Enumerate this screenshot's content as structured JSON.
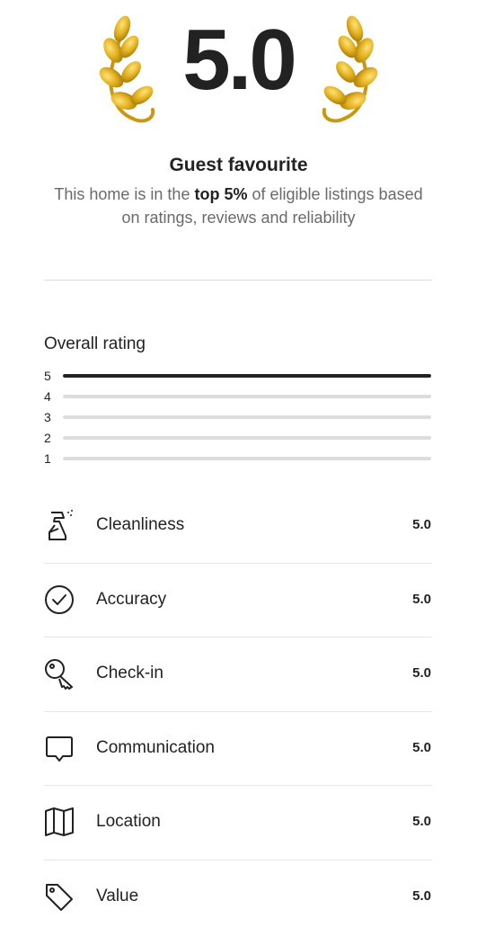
{
  "hero": {
    "score": "5.0",
    "title": "Guest favourite",
    "desc_prefix": "This home is in the ",
    "desc_highlight": "top 5%",
    "desc_suffix": " of eligible listings based on ratings, reviews and reliability",
    "laurel_color": "#D4A017"
  },
  "overall": {
    "title": "Overall rating",
    "bars": [
      {
        "label": "5",
        "fraction": 1.0
      },
      {
        "label": "4",
        "fraction": 0.0
      },
      {
        "label": "3",
        "fraction": 0.0
      },
      {
        "label": "2",
        "fraction": 0.0
      },
      {
        "label": "1",
        "fraction": 0.0
      }
    ]
  },
  "categories": [
    {
      "icon": "spray-bottle-icon",
      "label": "Cleanliness",
      "value": "5.0"
    },
    {
      "icon": "check-circle-icon",
      "label": "Accuracy",
      "value": "5.0"
    },
    {
      "icon": "key-icon",
      "label": "Check-in",
      "value": "5.0"
    },
    {
      "icon": "message-bubble-icon",
      "label": "Communication",
      "value": "5.0"
    },
    {
      "icon": "map-icon",
      "label": "Location",
      "value": "5.0"
    },
    {
      "icon": "price-tag-icon",
      "label": "Value",
      "value": "5.0"
    }
  ]
}
